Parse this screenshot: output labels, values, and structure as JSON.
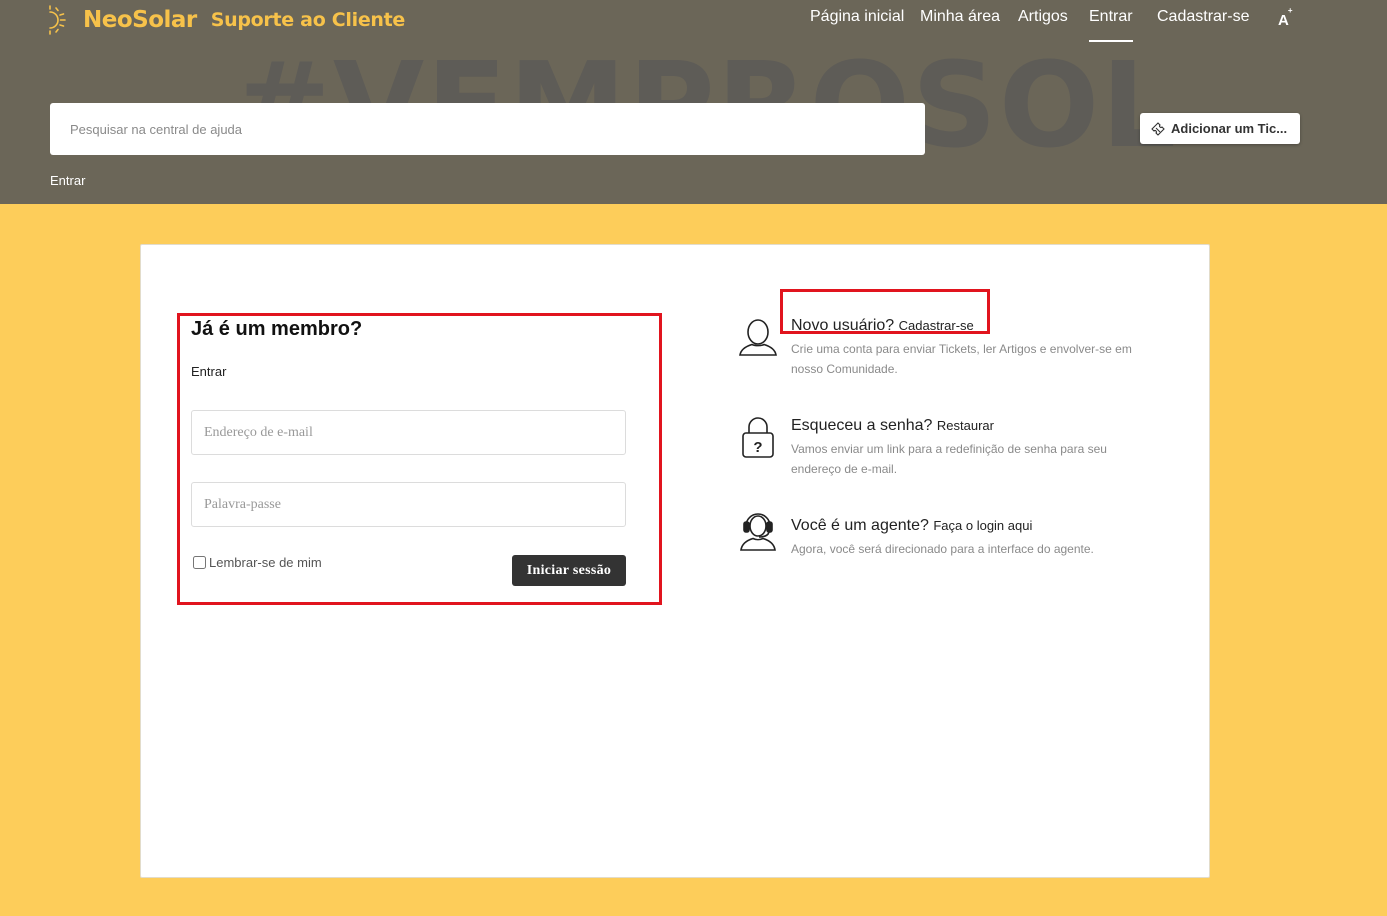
{
  "brand": {
    "name": "NeoSolar",
    "subtitle": "Suporte ao Cliente",
    "watermark": "#VEMPROSOL",
    "accent_color": "#f7c24a"
  },
  "nav": {
    "items": [
      {
        "label": "Página inicial",
        "active": false
      },
      {
        "label": "Minha área",
        "active": false
      },
      {
        "label": "Artigos",
        "active": false
      },
      {
        "label": "Entrar",
        "active": true
      },
      {
        "label": "Cadastrar-se",
        "active": false
      }
    ],
    "font_size_icon": "text-size-icon"
  },
  "search": {
    "placeholder": "Pesquisar na central de ajuda",
    "value": ""
  },
  "add_ticket": {
    "label": "Adicionar um Tic...",
    "icon": "ticket-icon"
  },
  "breadcrumb": "Entrar",
  "login": {
    "title": "Já é um membro?",
    "subtitle": "Entrar",
    "email_placeholder": "Endereço de e-mail",
    "password_placeholder": "Palavra-passe",
    "remember_label": "Lembrar-se de mim",
    "remember_checked": false,
    "submit_label": "Iniciar sessão"
  },
  "info": {
    "new_user": {
      "question": "Novo usuário?",
      "link": "Cadastrar-se",
      "description": "Crie uma conta para enviar Tickets, ler Artigos e envolver-se em nosso Comunidade.",
      "icon": "user-icon"
    },
    "forgot": {
      "question": "Esqueceu a senha?",
      "link": "Restaurar",
      "description": "Vamos enviar um link para a redefinição de senha para seu endereço de e-mail.",
      "icon": "lock-icon"
    },
    "agent": {
      "question": "Você é um agente?",
      "link": "Faça o login aqui",
      "description": "Agora, você será direcionado para a interface do agente.",
      "icon": "headset-icon"
    }
  },
  "colors": {
    "header_bg": "#6b6658",
    "page_bg": "#fdcd5a",
    "highlight": "#e1141e"
  }
}
